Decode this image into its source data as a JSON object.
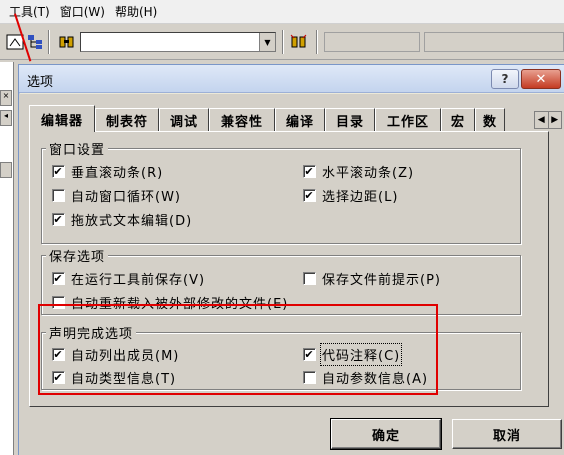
{
  "menu": [
    "工具(T)",
    "窗口(W)",
    "帮助(H)"
  ],
  "dialog": {
    "title": "选项",
    "help_label": "?",
    "close_label": "✕",
    "tabs": [
      "编辑器",
      "制表符",
      "调试",
      "兼容性",
      "编译",
      "目录",
      "工作区",
      "宏",
      "数"
    ],
    "groups": {
      "window": {
        "title": "窗口设置",
        "options": [
          {
            "label": "垂直滚动条(R)",
            "checked": true
          },
          {
            "label": "水平滚动条(Z)",
            "checked": true
          },
          {
            "label": "自动窗口循环(W)",
            "checked": false
          },
          {
            "label": "选择边距(L)",
            "checked": true
          },
          {
            "label": "拖放式文本编辑(D)",
            "checked": true
          }
        ]
      },
      "save": {
        "title": "保存选项",
        "options": [
          {
            "label": "在运行工具前保存(V)",
            "checked": true
          },
          {
            "label": "保存文件前提示(P)",
            "checked": false
          },
          {
            "label": "自动重新载入被外部修改的文件(E)",
            "checked": false
          }
        ]
      },
      "completion": {
        "title": "声明完成选项",
        "options": [
          {
            "label": "自动列出成员(M)",
            "checked": true
          },
          {
            "label": "代码注释(C)",
            "checked": true
          },
          {
            "label": "自动类型信息(T)",
            "checked": true
          },
          {
            "label": "自动参数信息(A)",
            "checked": false
          }
        ]
      }
    },
    "buttons": {
      "ok": "确定",
      "cancel": "取消"
    }
  },
  "colors": {
    "annotation": "#e00000",
    "dialog_face": "#d4d0c8"
  }
}
